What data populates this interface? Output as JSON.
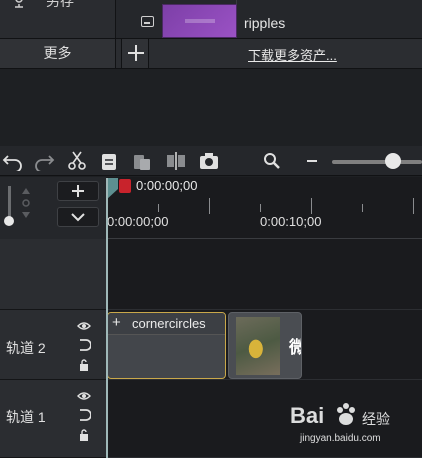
{
  "library": {
    "side_label": "另存",
    "media_name": "ripples",
    "more_label": "更多",
    "download_link": "下载更多资产..."
  },
  "toolbar": {
    "icons": [
      "undo-icon",
      "redo-icon",
      "cut-icon",
      "copy-icon",
      "paste-icon",
      "split-icon",
      "snapshot-icon",
      "zoom-icon",
      "zoom-out-icon"
    ],
    "zoom_level": 0.62
  },
  "timeline": {
    "playhead_time": "0:00:00;00",
    "tick_labels": [
      "0:00:00;00",
      "0:00:10;00"
    ]
  },
  "tracks": [
    {
      "label": "轨道 2"
    },
    {
      "label": "轨道 1"
    }
  ],
  "clips": {
    "clip1_name": "cornercircles",
    "clip2_text": "微"
  },
  "watermark": {
    "logo": "Bai",
    "brand": "经验",
    "url": "jingyan.baidu.com"
  }
}
